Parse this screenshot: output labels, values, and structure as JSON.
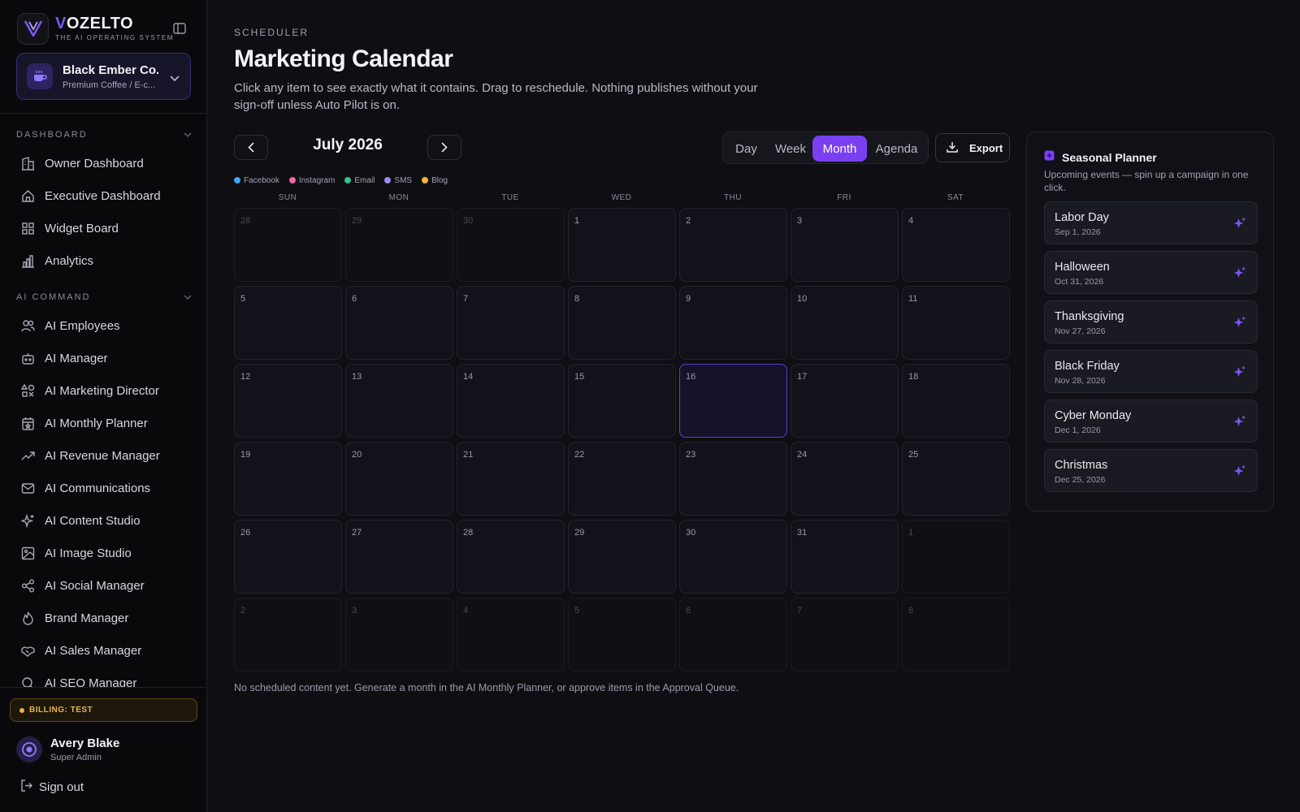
{
  "brand": {
    "name_first": "V",
    "name_rest": "OZELTO",
    "tagline": "THE AI OPERATING SYSTEM"
  },
  "workspace": {
    "name": "Black Ember Co...",
    "subtitle": "Premium Coffee / E-c..."
  },
  "sections": {
    "dashboard": {
      "label": "DASHBOARD",
      "items": [
        {
          "label": "Owner Dashboard",
          "icon": "building-icon"
        },
        {
          "label": "Executive Dashboard",
          "icon": "home-icon"
        },
        {
          "label": "Widget Board",
          "icon": "grid-icon"
        },
        {
          "label": "Analytics",
          "icon": "bar-chart-icon"
        }
      ]
    },
    "ai_command": {
      "label": "AI COMMAND",
      "items": [
        {
          "label": "AI Employees",
          "icon": "users-icon"
        },
        {
          "label": "AI Manager",
          "icon": "bot-icon"
        },
        {
          "label": "AI Marketing Director",
          "icon": "shapes-icon"
        },
        {
          "label": "AI Monthly Planner",
          "icon": "calendar-star-icon"
        },
        {
          "label": "AI Revenue Manager",
          "icon": "trending-up-icon"
        },
        {
          "label": "AI Communications",
          "icon": "mail-icon"
        },
        {
          "label": "AI Content Studio",
          "icon": "sparkles-icon"
        },
        {
          "label": "AI Image Studio",
          "icon": "image-icon"
        },
        {
          "label": "AI Social Manager",
          "icon": "share-icon"
        },
        {
          "label": "Brand Manager",
          "icon": "flame-icon"
        },
        {
          "label": "AI Sales Manager",
          "icon": "handshake-icon"
        },
        {
          "label": "AI SEO Manager",
          "icon": "search-icon"
        }
      ]
    }
  },
  "billing": {
    "label": "BILLING: TEST"
  },
  "user": {
    "name": "Avery Blake",
    "role": "Super Admin"
  },
  "signout": {
    "label": "Sign out"
  },
  "page": {
    "eyebrow": "SCHEDULER",
    "title": "Marketing Calendar",
    "subtitle": "Click any item to see exactly what it contains. Drag to reschedule. Nothing publishes without your sign-off unless Auto Pilot is on."
  },
  "calendar": {
    "month_label": "July 2026",
    "views": [
      "Day",
      "Week",
      "Month",
      "Agenda"
    ],
    "active_view": "Month",
    "export_label": "Export",
    "legend": [
      {
        "label": "Facebook",
        "color": "#3ba7f0"
      },
      {
        "label": "Instagram",
        "color": "#e96aa8"
      },
      {
        "label": "Email",
        "color": "#35c48d"
      },
      {
        "label": "SMS",
        "color": "#9d8cf5"
      },
      {
        "label": "Blog",
        "color": "#f0b53a"
      }
    ],
    "weekdays": [
      "SUN",
      "MON",
      "TUE",
      "WED",
      "THU",
      "FRI",
      "SAT"
    ],
    "days": [
      {
        "d": "28",
        "muted": true
      },
      {
        "d": "29",
        "muted": true
      },
      {
        "d": "30",
        "muted": true
      },
      {
        "d": "1"
      },
      {
        "d": "2"
      },
      {
        "d": "3"
      },
      {
        "d": "4"
      },
      {
        "d": "5"
      },
      {
        "d": "6"
      },
      {
        "d": "7"
      },
      {
        "d": "8"
      },
      {
        "d": "9"
      },
      {
        "d": "10"
      },
      {
        "d": "11"
      },
      {
        "d": "12"
      },
      {
        "d": "13"
      },
      {
        "d": "14"
      },
      {
        "d": "15"
      },
      {
        "d": "16",
        "today": true
      },
      {
        "d": "17"
      },
      {
        "d": "18"
      },
      {
        "d": "19"
      },
      {
        "d": "20"
      },
      {
        "d": "21"
      },
      {
        "d": "22"
      },
      {
        "d": "23"
      },
      {
        "d": "24"
      },
      {
        "d": "25"
      },
      {
        "d": "26"
      },
      {
        "d": "27"
      },
      {
        "d": "28"
      },
      {
        "d": "29"
      },
      {
        "d": "30"
      },
      {
        "d": "31"
      },
      {
        "d": "1",
        "muted": true
      },
      {
        "d": "2",
        "muted": true
      },
      {
        "d": "3",
        "muted": true
      },
      {
        "d": "4",
        "muted": true
      },
      {
        "d": "5",
        "muted": true
      },
      {
        "d": "6",
        "muted": true
      },
      {
        "d": "7",
        "muted": true
      },
      {
        "d": "8",
        "muted": true
      }
    ],
    "empty_note": "No scheduled content yet. Generate a month in the AI Monthly Planner, or approve items in the Approval Queue."
  },
  "planner": {
    "title": "Seasonal Planner",
    "subtitle": "Upcoming events — spin up a campaign in one click.",
    "events": [
      {
        "name": "Labor Day",
        "date": "Sep 1, 2026"
      },
      {
        "name": "Halloween",
        "date": "Oct 31, 2026"
      },
      {
        "name": "Thanksgiving",
        "date": "Nov 27, 2026"
      },
      {
        "name": "Black Friday",
        "date": "Nov 28, 2026"
      },
      {
        "name": "Cyber Monday",
        "date": "Dec 1, 2026"
      },
      {
        "name": "Christmas",
        "date": "Dec 25, 2026"
      }
    ]
  },
  "colors": {
    "accent": "#7b3ff2",
    "billing": "#e6b54a"
  }
}
